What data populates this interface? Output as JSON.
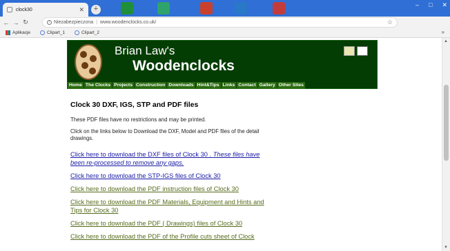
{
  "browser": {
    "tab_title": "clock30",
    "new_tab": "+",
    "address_security": "Niezabezpieczona",
    "address_url": "www.woodenclocks.co.uk/",
    "bookmarks": [
      "Aplikacje",
      "Clipart_1",
      "Clipart_2"
    ],
    "bookmarks_more": "»",
    "minimize": "–",
    "maximize": "□",
    "close": "✕",
    "profile_letter": "s"
  },
  "site": {
    "brand_line1": "Brian Law's",
    "brand_line2": "Woodenclocks",
    "menu": [
      "Home",
      "The Clocks",
      "Projects",
      "Construction",
      "Downloads",
      "Hint&Tips",
      "Links",
      "Contact",
      "Gallery",
      "Other Sites"
    ]
  },
  "content": {
    "heading": "Clock 30 DXF, IGS, STP and PDF files",
    "para1": "These PDF files have no restrictions and may be printed.",
    "para2": "Click on the links below to Download the DXF, Model and PDF files of the detail drawings.",
    "link_dxf": "Click here to download the DXF files of Clock 30 .",
    "link_dxf_note": "These files have been re-processed to remove any gaps.",
    "link_stp": "Click here to download the STP-IGS files of Clock 30",
    "link_pdf_instr": "Click here to download the PDF instruction files of Clock 30",
    "link_pdf_mat": "Click here to download the PDF Materials, Equipment and Hints and Tips for Clock 30",
    "link_pdf_draw": "Click here to download the PDF ( Drawings) files of Clock 30",
    "link_pdf_profile": "Click here to download the PDF of the Profile cuts sheet  of Clock"
  },
  "colors": {
    "banner_bg": "#043d04",
    "menu_bg": "#2a6b10",
    "link_blue": "#1a1aa6",
    "link_olive": "#556b1a",
    "chrome_blue": "#2f6fd6"
  }
}
